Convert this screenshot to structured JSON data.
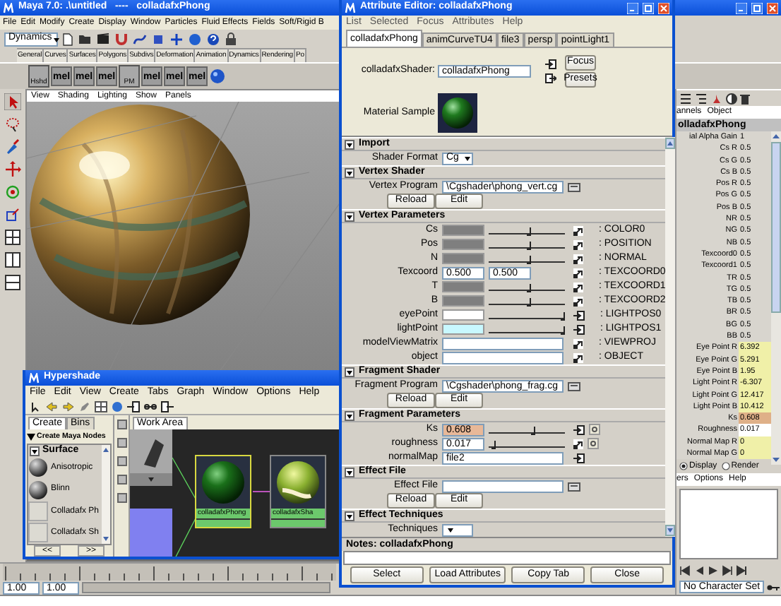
{
  "main_window": {
    "title": "Maya 7.0: .\\untitled   ----   colladafxPhong",
    "menus": [
      "File",
      "Edit",
      "Modify",
      "Create",
      "Display",
      "Window",
      "Particles",
      "Fluid Effects",
      "Fields",
      "Soft/Rigid B"
    ],
    "mode": "Dynamics",
    "shelf_tabs": [
      "General",
      "Curves",
      "Surfaces",
      "Polygons",
      "Subdivs",
      "Deformation",
      "Animation",
      "Dynamics",
      "Rendering",
      "Po"
    ],
    "shelf_items": [
      {
        "kind": "button",
        "label": "Hshd"
      },
      {
        "kind": "mel",
        "label": "mel"
      },
      {
        "kind": "mel",
        "label": "mel"
      },
      {
        "kind": "mel",
        "label": "mel"
      },
      {
        "kind": "button",
        "label": "PM"
      },
      {
        "kind": "mel",
        "label": "mel"
      },
      {
        "kind": "mel",
        "label": "mel"
      },
      {
        "kind": "mel",
        "label": "mel"
      },
      {
        "kind": "sphere"
      }
    ],
    "viewport_menus": [
      "View",
      "Shading",
      "Lighting",
      "Show",
      "Panels"
    ],
    "range": [
      "1.00",
      "1.00"
    ]
  },
  "channel_box": {
    "menus": [
      "annels",
      "Object"
    ],
    "node": "olladafxPhong",
    "channels": [
      {
        "name": "ial Alpha Gain",
        "value": "1",
        "kind": "default"
      },
      {
        "name": "Cs R",
        "value": "0.5",
        "kind": "default"
      },
      {
        "name": "Cs G",
        "value": "0.5",
        "kind": "default"
      },
      {
        "name": "Cs B",
        "value": "0.5",
        "kind": "default"
      },
      {
        "name": "Pos R",
        "value": "0.5",
        "kind": "default"
      },
      {
        "name": "Pos G",
        "value": "0.5",
        "kind": "default"
      },
      {
        "name": "Pos B",
        "value": "0.5",
        "kind": "default"
      },
      {
        "name": "NR",
        "value": "0.5",
        "kind": "default"
      },
      {
        "name": "NG",
        "value": "0.5",
        "kind": "default"
      },
      {
        "name": "NB",
        "value": "0.5",
        "kind": "default"
      },
      {
        "name": "Texcoord0",
        "value": "0.5",
        "kind": "default"
      },
      {
        "name": "Texcoord1",
        "value": "0.5",
        "kind": "default"
      },
      {
        "name": "TR",
        "value": "0.5",
        "kind": "default"
      },
      {
        "name": "TG",
        "value": "0.5",
        "kind": "default"
      },
      {
        "name": "TB",
        "value": "0.5",
        "kind": "default"
      },
      {
        "name": "BR",
        "value": "0.5",
        "kind": "default"
      },
      {
        "name": "BG",
        "value": "0.5",
        "kind": "default"
      },
      {
        "name": "BB",
        "value": "0.5",
        "kind": "default"
      },
      {
        "name": "Eye Point R",
        "value": "6.392",
        "kind": "connected"
      },
      {
        "name": "Eye Point G",
        "value": "5.291",
        "kind": "connected"
      },
      {
        "name": "Eye Point B",
        "value": "1.95",
        "kind": "connected"
      },
      {
        "name": "Light Point R",
        "value": "-6.307",
        "kind": "connected"
      },
      {
        "name": "Light Point G",
        "value": "12.417",
        "kind": "connected"
      },
      {
        "name": "Light Point B",
        "value": "10.412",
        "kind": "connected"
      },
      {
        "name": "Ks",
        "value": "0.608",
        "kind": "keyed"
      },
      {
        "name": "Roughness",
        "value": "0.017",
        "kind": "editable"
      },
      {
        "name": "Normal Map R",
        "value": "0",
        "kind": "connected"
      },
      {
        "name": "Normal Map G",
        "value": "0",
        "kind": "connected"
      }
    ],
    "layer_modes": [
      {
        "label": "Display",
        "selected": true
      },
      {
        "label": "Render",
        "selected": false
      }
    ],
    "layer_menus": [
      "ers",
      "Options",
      "Help"
    ],
    "character_set": "No Character Set"
  },
  "attribute_editor": {
    "title": "Attribute Editor: colladafxPhong",
    "menus": [
      "List",
      "Selected",
      "Focus",
      "Attributes",
      "Help"
    ],
    "tabs": [
      {
        "label": "colladafxPhong",
        "selected": true
      },
      {
        "label": "animCurveTU4",
        "selected": false
      },
      {
        "label": "file3",
        "selected": false
      },
      {
        "label": "persp",
        "selected": false
      },
      {
        "label": "pointLight1",
        "selected": false
      }
    ],
    "shader_label": "colladafxShader:",
    "shader_name": "colladafxPhong",
    "side_buttons": [
      "Focus",
      "Presets"
    ],
    "sample_label": "Material Sample",
    "sections": [
      {
        "title": "Import",
        "expanded": true,
        "rows": [
          {
            "kind": "dropdown",
            "label": "Shader Format",
            "value": "Cg"
          }
        ]
      },
      {
        "title": "Vertex Shader",
        "expanded": true,
        "rows": [
          {
            "kind": "file",
            "label": "Vertex Program",
            "value": "\\Cgshader\\phong_vert.cg"
          },
          {
            "kind": "buttons",
            "buttons": [
              "Reload",
              "Edit"
            ]
          }
        ]
      },
      {
        "title": "Vertex Parameters",
        "expanded": true,
        "rows": [
          {
            "kind": "color",
            "label": "Cs",
            "color": "#7f7f7f",
            "level": 0.55,
            "connected": false,
            "semantic": ": COLOR0"
          },
          {
            "kind": "color",
            "label": "Pos",
            "color": "#7f7f7f",
            "level": 0.55,
            "connected": false,
            "semantic": ": POSITION"
          },
          {
            "kind": "color",
            "label": "N",
            "color": "#7f7f7f",
            "level": 0.55,
            "connected": false,
            "semantic": ": NORMAL"
          },
          {
            "kind": "vector",
            "label": "Texcoord",
            "values": [
              "0.500",
              "0.500"
            ],
            "connected": false,
            "semantic": ": TEXCOORD0"
          },
          {
            "kind": "color",
            "label": "T",
            "color": "#7f7f7f",
            "level": 0.55,
            "connected": false,
            "semantic": ": TEXCOORD1"
          },
          {
            "kind": "color",
            "label": "B",
            "color": "#7f7f7f",
            "level": 0.55,
            "connected": false,
            "semantic": ": TEXCOORD2"
          },
          {
            "kind": "color",
            "label": "eyePoint",
            "color": "#ffffff",
            "level": 1.0,
            "connected": true,
            "semantic": ": LIGHTPOS0"
          },
          {
            "kind": "color",
            "label": "lightPoint",
            "color": "#c8f8ff",
            "level": 1.0,
            "connected": true,
            "semantic": ": LIGHTPOS1"
          },
          {
            "kind": "matrix",
            "label": "modelViewMatrix",
            "connected": false,
            "semantic": ": VIEWPROJ"
          },
          {
            "kind": "matrix",
            "label": "object",
            "connected": false,
            "semantic": ": OBJECT"
          }
        ]
      },
      {
        "title": "Fragment Shader",
        "expanded": true,
        "rows": [
          {
            "kind": "file",
            "label": "Fragment Program",
            "value": "\\Cgshader\\phong_frag.cg"
          },
          {
            "kind": "buttons",
            "buttons": [
              "Reload",
              "Edit"
            ]
          }
        ]
      },
      {
        "title": "Fragment Parameters",
        "expanded": true,
        "rows": [
          {
            "kind": "scalar",
            "label": "Ks",
            "value": "0.608",
            "keyed": true,
            "level": 0.62,
            "connected": true
          },
          {
            "kind": "scalar",
            "label": "roughness",
            "value": "0.017",
            "keyed": false,
            "level": 0.1,
            "connected": false
          },
          {
            "kind": "map",
            "label": "normalMap",
            "value": "file2",
            "connected": true
          }
        ]
      },
      {
        "title": "Effect File",
        "expanded": true,
        "rows": [
          {
            "kind": "file",
            "label": "Effect File"
          },
          {
            "kind": "buttons",
            "buttons": [
              "Reload",
              "Edit"
            ]
          }
        ]
      },
      {
        "title": "Effect Techniques",
        "expanded": true,
        "rows": [
          {
            "kind": "dropdown",
            "label": "Techniques"
          }
        ]
      }
    ],
    "notes_label": "Notes: colladafxPhong",
    "buttons": [
      "Select",
      "Load Attributes",
      "Copy Tab",
      "Close"
    ]
  },
  "hypershade": {
    "title": "Hypershade",
    "menus": [
      "File",
      "Edit",
      "View",
      "Create",
      "Tabs",
      "Graph",
      "Window",
      "Options",
      "Help"
    ],
    "tabs": [
      {
        "label": "Create",
        "selected": true
      },
      {
        "label": "Bins",
        "selected": false
      }
    ],
    "create_header": "Create Maya Nodes",
    "category": "Surface",
    "node_types": [
      {
        "label": "Anisotropic",
        "kind": "sphere"
      },
      {
        "label": "Blinn",
        "kind": "sphere"
      },
      {
        "label": "Colladafx Ph",
        "kind": "blank"
      },
      {
        "label": "Colladafx Sh",
        "kind": "blank"
      }
    ],
    "nav_buttons": [
      "<<",
      ">>"
    ],
    "work_tab": "Work Area",
    "graph_nodes": [
      {
        "label": "colladafxPhong",
        "kind": "material",
        "selected": true
      },
      {
        "label": "colladafxSha",
        "kind": "texture",
        "selected": false
      }
    ]
  }
}
